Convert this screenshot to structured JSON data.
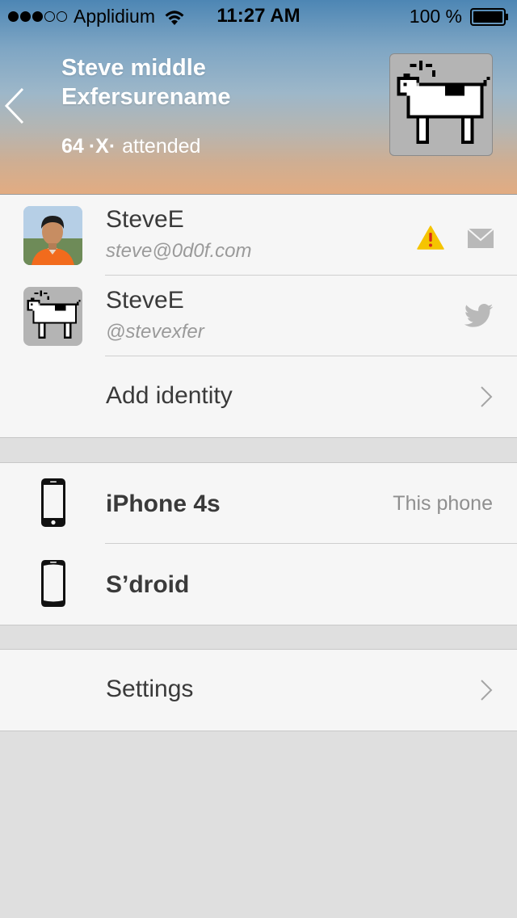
{
  "status_bar": {
    "carrier": "Applidium",
    "time": "11:27 AM",
    "battery": "100 %",
    "signal_bars_filled": 3,
    "signal_bars_total": 5
  },
  "profile": {
    "name": "Steve middle Exfersurename",
    "attended_count": "64",
    "attended_symbol": "·X·",
    "attended_label": "attended"
  },
  "identities": [
    {
      "name": "SteveE",
      "handle": "steve@0d0f.com",
      "avatar": "person-photo",
      "icons": [
        "warning-icon",
        "mail-icon"
      ]
    },
    {
      "name": "SteveE",
      "handle": "@stevexfer",
      "avatar": "dogcow",
      "icons": [
        "twitter-icon"
      ]
    }
  ],
  "add_identity_label": "Add identity",
  "devices": [
    {
      "name": "iPhone 4s",
      "detail": "This phone",
      "icon": "iphone-icon"
    },
    {
      "name": "S’droid",
      "detail": "",
      "icon": "android-phone-icon"
    }
  ],
  "settings_label": "Settings",
  "colors": {
    "warning": "#f5c400",
    "icon_gray": "#b9b9b9",
    "text_dark": "#3a3a3a",
    "text_light": "#9a9a9a"
  }
}
